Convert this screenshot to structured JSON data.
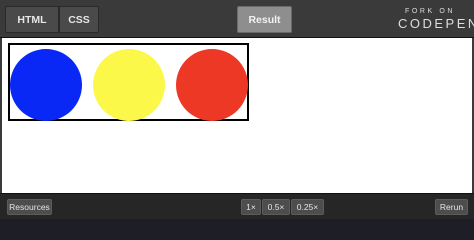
{
  "tabs": {
    "html": "HTML",
    "css": "CSS",
    "result": "Result"
  },
  "fork": {
    "label": "FORK ON",
    "brand": "CODEPEN"
  },
  "stage": {
    "circles": [
      {
        "name": "blue",
        "color": "#0a28f5"
      },
      {
        "name": "yellow",
        "color": "#fbf84a"
      },
      {
        "name": "red",
        "color": "#ee3826"
      }
    ]
  },
  "bottom": {
    "resources": "Resources",
    "zoom": [
      "1×",
      "0.5×",
      "0.25×"
    ],
    "rerun": "Rerun"
  }
}
